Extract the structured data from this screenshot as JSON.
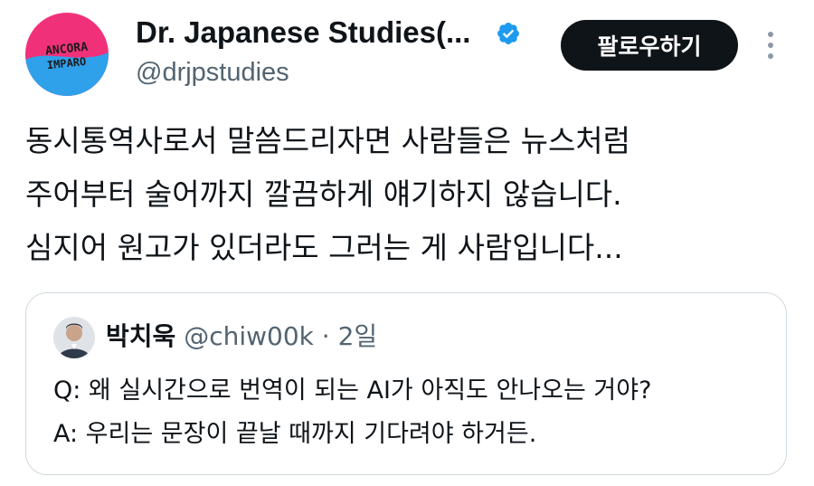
{
  "author": {
    "display_name": "Dr. Japanese Studies(...",
    "handle": "@drjpstudies",
    "avatar_text_line1": "ANCORA",
    "avatar_text_line2": "IMPARO",
    "verified": true,
    "verified_color": "#1d9bf0"
  },
  "actions": {
    "follow_label": "팔로우하기",
    "more_icon": "more-vertical-icon"
  },
  "tweet": {
    "lines": [
      "동시통역사로서 말씀드리자면 사람들은 뉴스처럼",
      "주어부터 술어까지 깔끔하게 얘기하지 않습니다.",
      "심지어 원고가 있더라도 그러는 게 사람입니다..."
    ]
  },
  "quote": {
    "display_name": "박치욱",
    "handle": "@chiw00k",
    "separator": "·",
    "time": "2일",
    "lines": [
      "Q: 왜 실시간으로 번역이 되는 AI가 아직도 안나오는 거야?",
      "A: 우리는 문장이 끝날 때까지 기다려야 하거든."
    ]
  },
  "colors": {
    "text_primary": "#0f1419",
    "text_secondary": "#536471",
    "border": "#cfd9de",
    "button_bg": "#0f1419",
    "avatar_pink": "#f0317a",
    "avatar_blue": "#2fa0ea"
  }
}
